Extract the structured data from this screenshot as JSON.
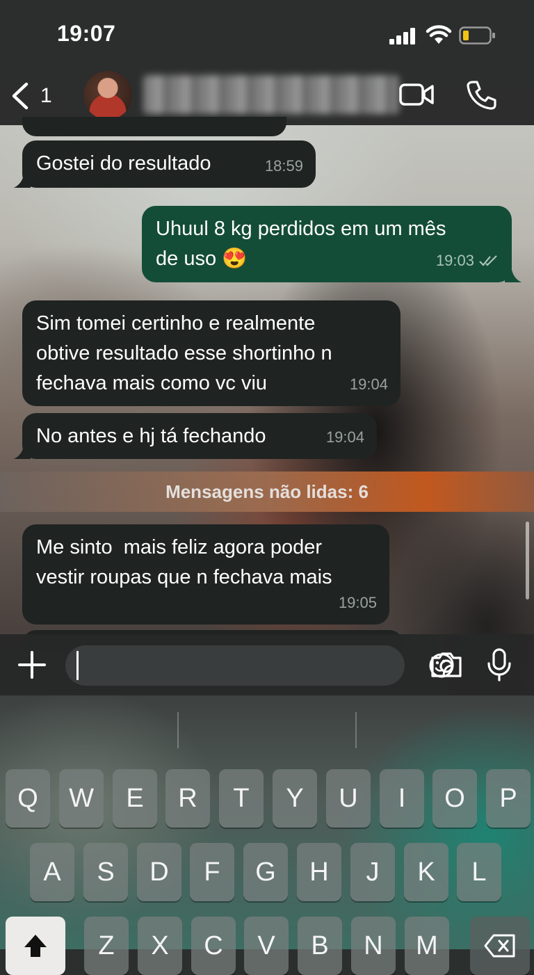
{
  "status_bar": {
    "time": "19:07"
  },
  "header": {
    "back_count": "1",
    "contact_name": "V"
  },
  "messages": [
    {
      "direction": "in",
      "text": "Gostei do resultado",
      "time": "18:59"
    },
    {
      "direction": "out",
      "text": "Uhuul 8 kg perdidos em um mês\nde uso 😍",
      "time": "19:03",
      "status": "read"
    },
    {
      "direction": "in",
      "text": "Sim tomei certinho e realmente\nobtive resultado esse shortinho n\nfechava mais como vc viu",
      "time": "19:04"
    },
    {
      "direction": "in",
      "text": "No antes e hj tá fechando",
      "time": "19:04"
    },
    {
      "direction": "in",
      "text": "Me sinto  mais feliz agora poder\nvestir roupas que n fechava mais",
      "time": "19:05"
    }
  ],
  "unread_banner": "Mensagens não lidas: 6",
  "input": {
    "value": ""
  },
  "keyboard": {
    "row1": [
      "Q",
      "W",
      "E",
      "R",
      "T",
      "Y",
      "U",
      "I",
      "O",
      "P"
    ],
    "row2": [
      "A",
      "S",
      "D",
      "F",
      "G",
      "H",
      "J",
      "K",
      "L"
    ],
    "row3": [
      "Z",
      "X",
      "C",
      "V",
      "B",
      "N",
      "M"
    ]
  },
  "colors": {
    "incoming_bubble": "#1f2322",
    "outgoing_bubble": "#144d37",
    "unread_accent": "#c85a1e"
  }
}
